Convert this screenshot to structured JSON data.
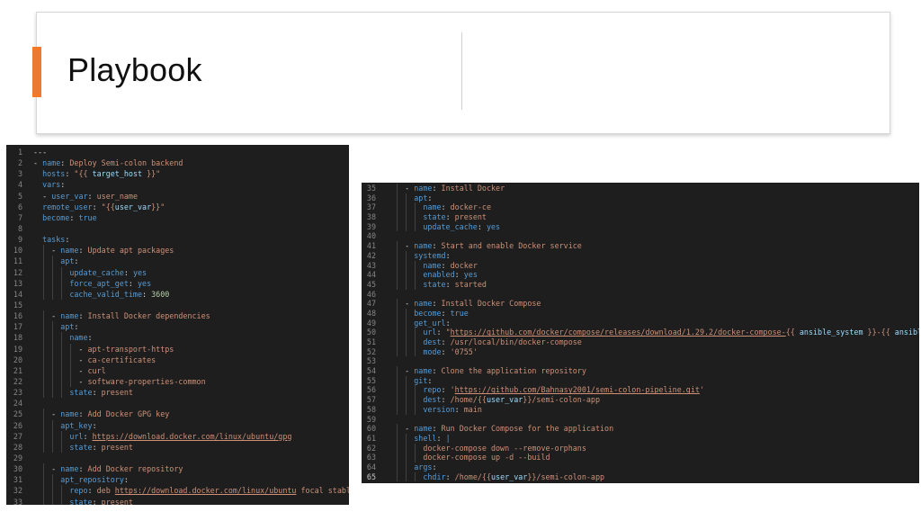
{
  "slide": {
    "title": "Playbook"
  },
  "colors": {
    "accent": "#ec7a31",
    "editor_bg": "#1e1e1e",
    "key": "#569cd6",
    "string": "#ce9178",
    "variable": "#9cdcfe",
    "number": "#b5cea8",
    "line_number": "#858585"
  },
  "left_editor": {
    "lines": [
      {
        "n": "1",
        "indent": 0,
        "tokens": [
          [
            "p",
            "---"
          ]
        ]
      },
      {
        "n": "2",
        "indent": 0,
        "tokens": [
          [
            "p",
            "- "
          ],
          [
            "k",
            "name"
          ],
          [
            "p",
            ": "
          ],
          [
            "s",
            "Deploy Semi-colon backend"
          ]
        ]
      },
      {
        "n": "3",
        "indent": 1,
        "tokens": [
          [
            "k",
            "hosts"
          ],
          [
            "p",
            ": "
          ],
          [
            "s",
            "\"{{ "
          ],
          [
            "v",
            "target_host"
          ],
          [
            "s",
            " }}\""
          ]
        ]
      },
      {
        "n": "4",
        "indent": 1,
        "tokens": [
          [
            "k",
            "vars"
          ],
          [
            "p",
            ":"
          ]
        ]
      },
      {
        "n": "5",
        "indent": 1,
        "tokens": [
          [
            "p",
            "- "
          ],
          [
            "k",
            "user_var"
          ],
          [
            "p",
            ": "
          ],
          [
            "s",
            "user_name"
          ]
        ]
      },
      {
        "n": "6",
        "indent": 1,
        "tokens": [
          [
            "k",
            "remote_user"
          ],
          [
            "p",
            ": "
          ],
          [
            "s",
            "\"{{"
          ],
          [
            "v",
            "user_var"
          ],
          [
            "s",
            "}}\""
          ]
        ]
      },
      {
        "n": "7",
        "indent": 1,
        "tokens": [
          [
            "k",
            "become"
          ],
          [
            "p",
            ": "
          ],
          [
            "b",
            "true"
          ]
        ]
      },
      {
        "n": "8",
        "indent": 0,
        "tokens": []
      },
      {
        "n": "9",
        "indent": 1,
        "tokens": [
          [
            "k",
            "tasks"
          ],
          [
            "p",
            ":"
          ]
        ]
      },
      {
        "n": "10",
        "indent": 2,
        "tokens": [
          [
            "p",
            "- "
          ],
          [
            "k",
            "name"
          ],
          [
            "p",
            ": "
          ],
          [
            "s",
            "Update apt packages"
          ]
        ]
      },
      {
        "n": "11",
        "indent": 3,
        "tokens": [
          [
            "k",
            "apt"
          ],
          [
            "p",
            ":"
          ]
        ]
      },
      {
        "n": "12",
        "indent": 4,
        "tokens": [
          [
            "k",
            "update_cache"
          ],
          [
            "p",
            ": "
          ],
          [
            "b",
            "yes"
          ]
        ]
      },
      {
        "n": "13",
        "indent": 4,
        "tokens": [
          [
            "k",
            "force_apt_get"
          ],
          [
            "p",
            ": "
          ],
          [
            "b",
            "yes"
          ]
        ]
      },
      {
        "n": "14",
        "indent": 4,
        "tokens": [
          [
            "k",
            "cache_valid_time"
          ],
          [
            "p",
            ": "
          ],
          [
            "n",
            "3600"
          ]
        ]
      },
      {
        "n": "15",
        "indent": 0,
        "tokens": []
      },
      {
        "n": "16",
        "indent": 2,
        "tokens": [
          [
            "p",
            "- "
          ],
          [
            "k",
            "name"
          ],
          [
            "p",
            ": "
          ],
          [
            "s",
            "Install Docker dependencies"
          ]
        ]
      },
      {
        "n": "17",
        "indent": 3,
        "tokens": [
          [
            "k",
            "apt"
          ],
          [
            "p",
            ":"
          ]
        ]
      },
      {
        "n": "18",
        "indent": 4,
        "tokens": [
          [
            "k",
            "name"
          ],
          [
            "p",
            ":"
          ]
        ]
      },
      {
        "n": "19",
        "indent": 5,
        "tokens": [
          [
            "p",
            "- "
          ],
          [
            "s",
            "apt-transport-https"
          ]
        ]
      },
      {
        "n": "20",
        "indent": 5,
        "tokens": [
          [
            "p",
            "- "
          ],
          [
            "s",
            "ca-certificates"
          ]
        ]
      },
      {
        "n": "21",
        "indent": 5,
        "tokens": [
          [
            "p",
            "- "
          ],
          [
            "s",
            "curl"
          ]
        ]
      },
      {
        "n": "22",
        "indent": 5,
        "tokens": [
          [
            "p",
            "- "
          ],
          [
            "s",
            "software-properties-common"
          ]
        ]
      },
      {
        "n": "23",
        "indent": 4,
        "tokens": [
          [
            "k",
            "state"
          ],
          [
            "p",
            ": "
          ],
          [
            "s",
            "present"
          ]
        ]
      },
      {
        "n": "24",
        "indent": 0,
        "tokens": []
      },
      {
        "n": "25",
        "indent": 2,
        "tokens": [
          [
            "p",
            "- "
          ],
          [
            "k",
            "name"
          ],
          [
            "p",
            ": "
          ],
          [
            "s",
            "Add Docker GPG key"
          ]
        ]
      },
      {
        "n": "26",
        "indent": 3,
        "tokens": [
          [
            "k",
            "apt_key"
          ],
          [
            "p",
            ":"
          ]
        ]
      },
      {
        "n": "27",
        "indent": 4,
        "tokens": [
          [
            "k",
            "url"
          ],
          [
            "p",
            ": "
          ],
          [
            "u",
            "https://download.docker.com/linux/ubuntu/gpg"
          ]
        ]
      },
      {
        "n": "28",
        "indent": 4,
        "tokens": [
          [
            "k",
            "state"
          ],
          [
            "p",
            ": "
          ],
          [
            "s",
            "present"
          ]
        ]
      },
      {
        "n": "29",
        "indent": 0,
        "tokens": []
      },
      {
        "n": "30",
        "indent": 2,
        "tokens": [
          [
            "p",
            "- "
          ],
          [
            "k",
            "name"
          ],
          [
            "p",
            ": "
          ],
          [
            "s",
            "Add Docker repository"
          ]
        ]
      },
      {
        "n": "31",
        "indent": 3,
        "tokens": [
          [
            "k",
            "apt_repository"
          ],
          [
            "p",
            ":"
          ]
        ]
      },
      {
        "n": "32",
        "indent": 4,
        "tokens": [
          [
            "k",
            "repo"
          ],
          [
            "p",
            ": "
          ],
          [
            "s",
            "deb "
          ],
          [
            "u",
            "https://download.docker.com/linux/ubuntu"
          ],
          [
            "s",
            " focal stable"
          ]
        ]
      },
      {
        "n": "33",
        "indent": 4,
        "tokens": [
          [
            "k",
            "state"
          ],
          [
            "p",
            ": "
          ],
          [
            "s",
            "present"
          ]
        ]
      }
    ]
  },
  "right_editor": {
    "lines": [
      {
        "n": "35",
        "indent": 2,
        "tokens": [
          [
            "p",
            "- "
          ],
          [
            "k",
            "name"
          ],
          [
            "p",
            ": "
          ],
          [
            "s",
            "Install Docker"
          ]
        ]
      },
      {
        "n": "36",
        "indent": 3,
        "tokens": [
          [
            "k",
            "apt"
          ],
          [
            "p",
            ":"
          ]
        ]
      },
      {
        "n": "37",
        "indent": 4,
        "tokens": [
          [
            "k",
            "name"
          ],
          [
            "p",
            ": "
          ],
          [
            "s",
            "docker-ce"
          ]
        ]
      },
      {
        "n": "38",
        "indent": 4,
        "tokens": [
          [
            "k",
            "state"
          ],
          [
            "p",
            ": "
          ],
          [
            "s",
            "present"
          ]
        ]
      },
      {
        "n": "39",
        "indent": 4,
        "tokens": [
          [
            "k",
            "update_cache"
          ],
          [
            "p",
            ": "
          ],
          [
            "b",
            "yes"
          ]
        ]
      },
      {
        "n": "40",
        "indent": 0,
        "tokens": []
      },
      {
        "n": "41",
        "indent": 2,
        "tokens": [
          [
            "p",
            "- "
          ],
          [
            "k",
            "name"
          ],
          [
            "p",
            ": "
          ],
          [
            "s",
            "Start and enable Docker service"
          ]
        ]
      },
      {
        "n": "42",
        "indent": 3,
        "tokens": [
          [
            "k",
            "systemd"
          ],
          [
            "p",
            ":"
          ]
        ]
      },
      {
        "n": "43",
        "indent": 4,
        "tokens": [
          [
            "k",
            "name"
          ],
          [
            "p",
            ": "
          ],
          [
            "s",
            "docker"
          ]
        ]
      },
      {
        "n": "44",
        "indent": 4,
        "tokens": [
          [
            "k",
            "enabled"
          ],
          [
            "p",
            ": "
          ],
          [
            "b",
            "yes"
          ]
        ]
      },
      {
        "n": "45",
        "indent": 4,
        "tokens": [
          [
            "k",
            "state"
          ],
          [
            "p",
            ": "
          ],
          [
            "s",
            "started"
          ]
        ]
      },
      {
        "n": "46",
        "indent": 0,
        "tokens": []
      },
      {
        "n": "47",
        "indent": 2,
        "tokens": [
          [
            "p",
            "- "
          ],
          [
            "k",
            "name"
          ],
          [
            "p",
            ": "
          ],
          [
            "s",
            "Install Docker Compose"
          ]
        ]
      },
      {
        "n": "48",
        "indent": 3,
        "tokens": [
          [
            "k",
            "become"
          ],
          [
            "p",
            ": "
          ],
          [
            "b",
            "true"
          ]
        ]
      },
      {
        "n": "49",
        "indent": 3,
        "tokens": [
          [
            "k",
            "get_url"
          ],
          [
            "p",
            ":"
          ]
        ]
      },
      {
        "n": "50",
        "indent": 4,
        "tokens": [
          [
            "k",
            "url"
          ],
          [
            "p",
            ": "
          ],
          [
            "s",
            "\""
          ],
          [
            "u",
            "https://github.com/docker/compose/releases/download/1.29.2/docker-compose-"
          ],
          [
            "s",
            "{{ "
          ],
          [
            "v",
            "ansible_system"
          ],
          [
            "s",
            " }}-{{ "
          ],
          [
            "v",
            "ansible_architecture"
          ],
          [
            "s",
            " }"
          ]
        ]
      },
      {
        "n": "51",
        "indent": 4,
        "tokens": [
          [
            "k",
            "dest"
          ],
          [
            "p",
            ": "
          ],
          [
            "s",
            "/usr/local/bin/docker-compose"
          ]
        ]
      },
      {
        "n": "52",
        "indent": 4,
        "tokens": [
          [
            "k",
            "mode"
          ],
          [
            "p",
            ": "
          ],
          [
            "s",
            "'0755'"
          ]
        ]
      },
      {
        "n": "53",
        "indent": 0,
        "tokens": []
      },
      {
        "n": "54",
        "indent": 2,
        "tokens": [
          [
            "p",
            "- "
          ],
          [
            "k",
            "name"
          ],
          [
            "p",
            ": "
          ],
          [
            "s",
            "Clone the application repository"
          ]
        ]
      },
      {
        "n": "55",
        "indent": 3,
        "tokens": [
          [
            "k",
            "git"
          ],
          [
            "p",
            ":"
          ]
        ]
      },
      {
        "n": "56",
        "indent": 4,
        "tokens": [
          [
            "k",
            "repo"
          ],
          [
            "p",
            ": "
          ],
          [
            "s",
            "'"
          ],
          [
            "u",
            "https://github.com/Bahnasy2001/semi-colon-pipeline.git"
          ],
          [
            "s",
            "'"
          ]
        ]
      },
      {
        "n": "57",
        "indent": 4,
        "tokens": [
          [
            "k",
            "dest"
          ],
          [
            "p",
            ": "
          ],
          [
            "s",
            "/home/{{"
          ],
          [
            "v",
            "user_var"
          ],
          [
            "s",
            "}}/semi-colon-app"
          ]
        ]
      },
      {
        "n": "58",
        "indent": 4,
        "tokens": [
          [
            "k",
            "version"
          ],
          [
            "p",
            ": "
          ],
          [
            "s",
            "main"
          ]
        ]
      },
      {
        "n": "59",
        "indent": 0,
        "tokens": []
      },
      {
        "n": "60",
        "indent": 2,
        "tokens": [
          [
            "p",
            "- "
          ],
          [
            "k",
            "name"
          ],
          [
            "p",
            ": "
          ],
          [
            "s",
            "Run Docker Compose for the application"
          ]
        ]
      },
      {
        "n": "61",
        "indent": 3,
        "tokens": [
          [
            "k",
            "shell"
          ],
          [
            "p",
            ": "
          ],
          [
            "b",
            "|"
          ]
        ]
      },
      {
        "n": "62",
        "indent": 4,
        "tokens": [
          [
            "s",
            "docker-compose down --remove-orphans"
          ]
        ]
      },
      {
        "n": "63",
        "indent": 4,
        "tokens": [
          [
            "s",
            "docker-compose up -d --build"
          ]
        ]
      },
      {
        "n": "64",
        "indent": 3,
        "tokens": [
          [
            "k",
            "args"
          ],
          [
            "p",
            ":"
          ]
        ]
      },
      {
        "n": "65",
        "indent": 4,
        "active": true,
        "tokens": [
          [
            "k",
            "chdir"
          ],
          [
            "p",
            ": "
          ],
          [
            "s",
            "/home/{{"
          ],
          [
            "v",
            "user_var"
          ],
          [
            "s",
            "}}/semi-colon-app"
          ]
        ]
      }
    ]
  }
}
